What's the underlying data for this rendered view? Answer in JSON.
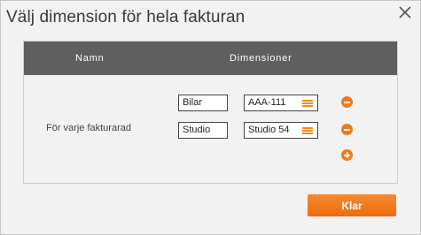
{
  "dialog": {
    "title": "Välj dimension för hela fakturan",
    "close_icon": "close-x-icon"
  },
  "table": {
    "headers": {
      "name": "Namn",
      "dimensions": "Dimensioner"
    },
    "row_label": "För varje fakturarad",
    "dimension_rows": [
      {
        "dimension": "Bilar",
        "value": "AAA-111",
        "menu_icon": "list-menu-icon",
        "action_icon": "minus-circle-icon"
      },
      {
        "dimension": "Studio",
        "value": "Studio 54",
        "menu_icon": "list-menu-icon",
        "action_icon": "minus-circle-icon"
      }
    ],
    "add_icon": "plus-circle-icon"
  },
  "footer": {
    "done_label": "Klar"
  },
  "colors": {
    "accent": "#f07a1a",
    "header_bg": "#5f5f5f",
    "page_bg": "#f2f2f2"
  }
}
